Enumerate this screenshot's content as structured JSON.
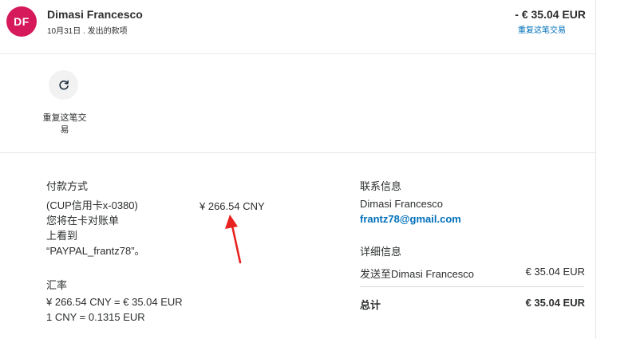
{
  "header": {
    "avatar_initials": "DF",
    "avatar_color": "#d6195a",
    "name": "Dimasi Francesco",
    "subtitle": "10月31日 . 发出的款项",
    "amount": "- € 35.04 EUR",
    "repeat_link": "重复这笔交易"
  },
  "repeat_action": {
    "icon": "refresh-icon",
    "label": "重复这笔交易"
  },
  "payment": {
    "title": "付款方式",
    "method_line1": "(CUP信用卡x-0380)",
    "method_line2": "您将在卡对账单",
    "method_line3": "上看到",
    "method_line4": "“PAYPAL_frantz78”。",
    "amount": "¥ 266.54 CNY"
  },
  "exchange": {
    "title": "汇率",
    "line1": "¥ 266.54 CNY = € 35.04 EUR",
    "line2": "1 CNY = 0.1315 EUR"
  },
  "contact": {
    "title": "联系信息",
    "name": "Dimasi Francesco",
    "email": "frantz78@gmail.com"
  },
  "details": {
    "title": "详细信息",
    "sent_to": "发送至Dimasi Francesco",
    "sent_amount": "€ 35.04 EUR",
    "total_label": "总计",
    "total_amount": "€ 35.04 EUR"
  },
  "colors": {
    "link": "#0070ba",
    "annotation_arrow": "#e8231f"
  }
}
